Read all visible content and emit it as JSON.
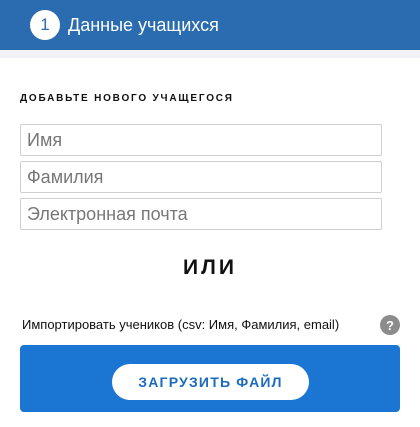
{
  "header": {
    "step_number": "1",
    "title": "Данные учащихся"
  },
  "form": {
    "section_label": "ДОБАВЬТЕ НОВОГО УЧАЩЕГОСЯ",
    "first_name_placeholder": "Имя",
    "last_name_placeholder": "Фамилия",
    "email_placeholder": "Электронная почта",
    "first_name_value": "",
    "last_name_value": "",
    "email_value": ""
  },
  "divider_text": "ИЛИ",
  "import": {
    "label": "Импортировать учеников (csv: Имя, Фамилия, email)",
    "help_icon": "question-mark-icon",
    "help_glyph": "?",
    "upload_label": "ЗАГРУЗИТЬ ФАЙЛ"
  },
  "colors": {
    "header_bg": "#2b6cb0",
    "upload_panel_bg": "#1a76d2",
    "help_icon_bg": "#8c8c8c"
  }
}
